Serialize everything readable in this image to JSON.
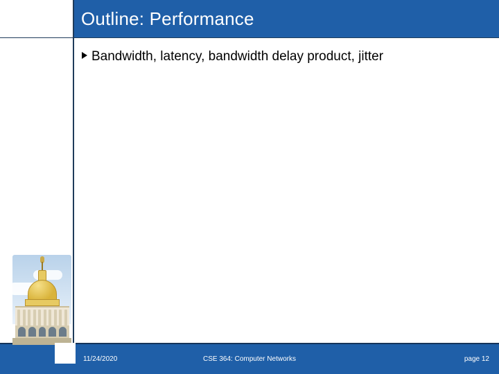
{
  "title": "Outline: Performance",
  "bullets": [
    "Bandwidth, latency, bandwidth delay product, jitter"
  ],
  "footer": {
    "date": "11/24/2020",
    "course": "CSE 364: Computer Networks",
    "page": "page 12"
  },
  "colors": {
    "header": "#1f5fa8",
    "rule": "#1f3b5a"
  }
}
